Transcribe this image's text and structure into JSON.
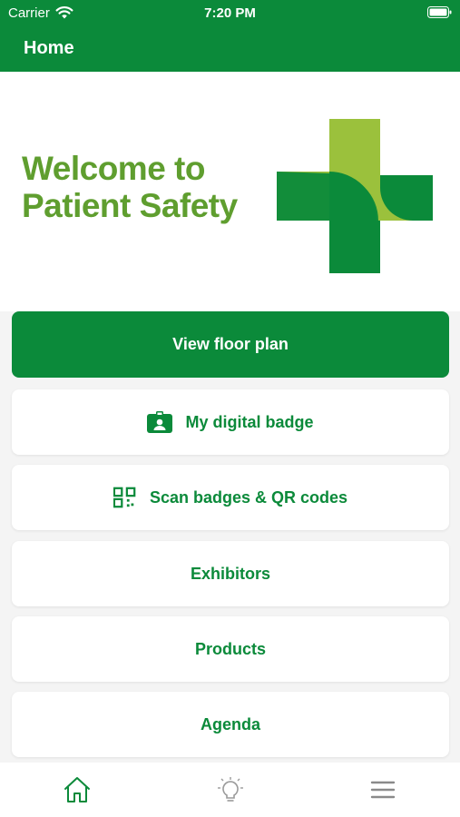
{
  "status_bar": {
    "carrier": "Carrier",
    "time": "7:20 PM"
  },
  "header": {
    "title": "Home"
  },
  "banner": {
    "line1": "Welcome to",
    "line2": "Patient Safety"
  },
  "buttons": {
    "floor_plan": "View floor plan",
    "digital_badge": "My digital badge",
    "scan": "Scan badges & QR codes",
    "exhibitors": "Exhibitors",
    "products": "Products",
    "agenda": "Agenda"
  },
  "tabs": [
    {
      "icon": "home-icon",
      "active": true
    },
    {
      "icon": "lightbulb-icon",
      "active": false
    },
    {
      "icon": "menu-icon",
      "active": false
    }
  ],
  "colors": {
    "brand_green": "#0b8a3a",
    "light_green": "#9bc13c",
    "text_green": "#5f9e2f",
    "background": "#f4f4f4"
  }
}
